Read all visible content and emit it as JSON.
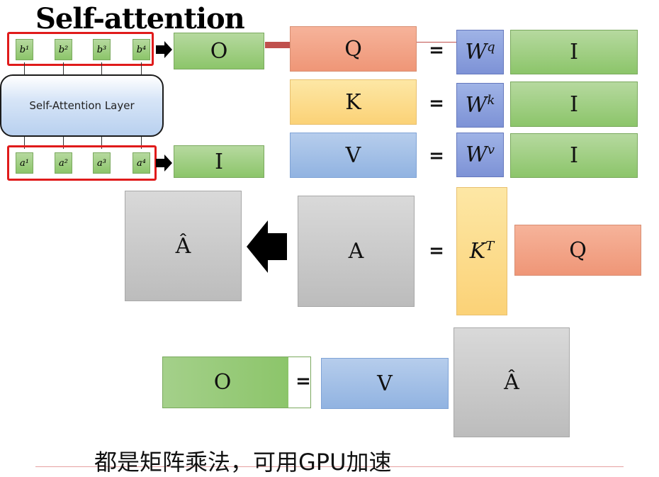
{
  "title": "Self-attention",
  "layer": {
    "label": "Self-Attention Layer"
  },
  "outputs": [
    "b¹",
    "b²",
    "b³",
    "b⁴"
  ],
  "inputs": [
    "a¹",
    "a²",
    "a³",
    "a⁴"
  ],
  "out_matrix": "O",
  "in_matrix": "I",
  "equations": {
    "q": {
      "lhs": "Q",
      "eq": "=",
      "w": "Wq",
      "rhs": "I"
    },
    "k": {
      "lhs": "K",
      "eq": "=",
      "w": "Wk",
      "rhs": "I"
    },
    "v": {
      "lhs": "V",
      "eq": "=",
      "w": "Wv",
      "rhs": "I"
    }
  },
  "attention": {
    "a_hat": "Â",
    "a": "A",
    "eq": "=",
    "kt": "KT",
    "q": "Q"
  },
  "output_eq": {
    "o": "O",
    "eq": "=",
    "v": "V",
    "a_hat": "Â"
  },
  "note": "都是矩阵乘法，可用GPU加速",
  "colors": {
    "green": "#8cc56a",
    "orange": "#ef9677",
    "yellow": "#fbd277",
    "blue": "#91b3e1",
    "gray": "#bcbcbc",
    "red": "#e01b1b"
  }
}
